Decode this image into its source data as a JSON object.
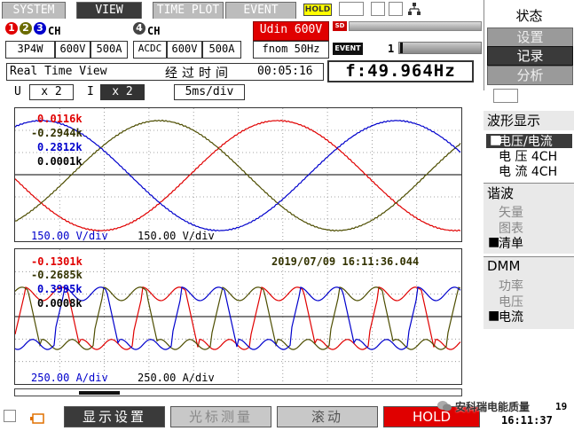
{
  "tabs": [
    {
      "label": "SYSTEM",
      "active": false
    },
    {
      "label": "VIEW",
      "active": true
    },
    {
      "label": "TIME PLOT",
      "active": false
    },
    {
      "label": "EVENT",
      "active": false
    }
  ],
  "hold_badge": "HOLD",
  "channel_group_1": {
    "numbers": [
      "1",
      "2",
      "3"
    ],
    "suffix": "CH",
    "wiring": "3P4W",
    "voltage_range": "600V",
    "current_range": "500A"
  },
  "channel_group_2": {
    "number": "4",
    "suffix": "CH",
    "coupling": "ACDC",
    "voltage_range": "600V",
    "current_range": "500A"
  },
  "udin": "Udin 600V",
  "fnom": "fnom  50Hz",
  "sd_label": "SD",
  "event_label": "EVENT",
  "event_count": "1",
  "view_title": "Real Time View",
  "elapsed_label": "经过时间",
  "elapsed_value": "00:05:16",
  "frequency": "f:49.964Hz",
  "zoom": {
    "u_label": "U",
    "u_value": "x 2",
    "i_label": "I",
    "i_value": "x 2",
    "timebase": "5ms/div"
  },
  "voltage_panel": {
    "readouts": [
      {
        "text": "0.0116k",
        "color": "#e00000"
      },
      {
        "text": "-0.2944k",
        "color": "#333300"
      },
      {
        "text": "0.2812k",
        "color": "#0000cc"
      },
      {
        "text": "0.0001k",
        "color": "#000000"
      }
    ],
    "scale_left": "150.00 V/div",
    "scale_right": "150.00 V/div"
  },
  "current_panel": {
    "readouts": [
      {
        "text": "-0.1301k",
        "color": "#e00000"
      },
      {
        "text": "-0.2685k",
        "color": "#333300"
      },
      {
        "text": "0.3995k",
        "color": "#0000cc"
      },
      {
        "text": "0.0008k",
        "color": "#000000"
      }
    ],
    "timestamp": "2019/07/09 16:11:36.044",
    "scale_left": "250.00 A/div",
    "scale_right": "250.00 A/div"
  },
  "right_menu": {
    "status": "状态",
    "settings": "设置",
    "record": "记录",
    "analysis": "分析",
    "waveform_header": "波形显示",
    "waveform_items": [
      "电压/电流",
      "电 压 4CH",
      "电 流 4CH"
    ],
    "harmonic_header": "谐波",
    "harmonic_items": [
      "矢量",
      "图表",
      "清单"
    ],
    "dmm_header": "DMM",
    "dmm_items": [
      "功率",
      "电压",
      "电流"
    ]
  },
  "bottom": {
    "display_settings": "显示设置",
    "cursor_measure": "光标测量",
    "scroll": "滚动",
    "hold": "HOLD",
    "watermark": "安科瑞电能质量",
    "clock_date": "19",
    "clock_time": "16:11:37"
  },
  "colors": {
    "phase1": "#e00000",
    "phase2": "#4d4d00",
    "phase3": "#0000cc",
    "neutral": "#000000"
  }
}
